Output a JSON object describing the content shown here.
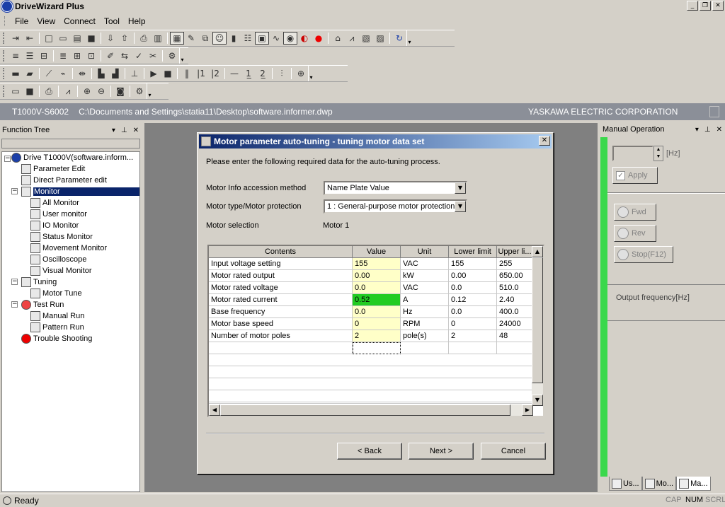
{
  "app": {
    "title": "DriveWizard Plus"
  },
  "window_controls": {
    "minimize": "_",
    "restore": "❐",
    "close": "✕"
  },
  "menu": [
    "File",
    "View",
    "Connect",
    "Tool",
    "Help"
  ],
  "pathbar": {
    "model": "T1000V-S6002",
    "path": "C:\\Documents and Settings\\statia11\\Desktop\\software.informer.dwp",
    "corp": "YASKAWA ELECTRIC CORPORATION"
  },
  "function_tree": {
    "title": "Function Tree",
    "nodes": [
      {
        "label": "Drive T1000V(software.inform...",
        "icon": "drive-icon"
      },
      {
        "label": "Parameter Edit",
        "icon": "parameter-edit-icon"
      },
      {
        "label": "Direct Parameter edit",
        "icon": "direct-parameter-icon"
      },
      {
        "label": "Monitor",
        "icon": "monitor-icon"
      },
      {
        "label": "All Monitor",
        "icon": "all-monitor-icon"
      },
      {
        "label": "User monitor",
        "icon": "user-monitor-icon"
      },
      {
        "label": "IO Monitor",
        "icon": "io-monitor-icon"
      },
      {
        "label": "Status Monitor",
        "icon": "status-monitor-icon"
      },
      {
        "label": "Movement Monitor",
        "icon": "movement-monitor-icon"
      },
      {
        "label": "Oscilloscope",
        "icon": "oscilloscope-icon"
      },
      {
        "label": "Visual Monitor",
        "icon": "visual-monitor-icon"
      },
      {
        "label": "Tuning",
        "icon": "tuning-icon"
      },
      {
        "label": "Motor Tune",
        "icon": "motor-tune-icon"
      },
      {
        "label": "Test Run",
        "icon": "test-run-icon"
      },
      {
        "label": "Manual Run",
        "icon": "manual-run-icon"
      },
      {
        "label": "Pattern Run",
        "icon": "pattern-run-icon"
      },
      {
        "label": "Trouble Shooting",
        "icon": "trouble-shooting-icon"
      }
    ]
  },
  "dialog": {
    "title": "Motor parameter auto-tuning - tuning motor data set",
    "instruction": "Please enter the following required data for the auto-tuning process.",
    "info_method_label": "Motor Info accession method",
    "info_method_value": "Name Plate Value",
    "motor_type_label": "Motor type/Motor protection",
    "motor_type_value": "1 : General-purpose motor protection",
    "motor_selection_label": "Motor selection",
    "motor_selection_value": "Motor 1",
    "table": {
      "headers": [
        "Contents",
        "Value",
        "Unit",
        "Lower limit",
        "Upper li..."
      ],
      "rows": [
        [
          "Input voltage setting",
          "155",
          "VAC",
          "155",
          "255"
        ],
        [
          "Motor rated output",
          "0.00",
          "kW",
          "0.00",
          "650.00"
        ],
        [
          "Motor rated voltage",
          "0.0",
          "VAC",
          "0.0",
          "510.0"
        ],
        [
          "Motor rated current",
          "0.52",
          "A",
          "0.12",
          "2.40"
        ],
        [
          "Base frequency",
          "0.0",
          "Hz",
          "0.0",
          "400.0"
        ],
        [
          "Motor base speed",
          "0",
          "RPM",
          "0",
          "24000"
        ],
        [
          "Number of motor poles",
          "2",
          "pole(s)",
          "2",
          "48"
        ]
      ]
    },
    "buttons": {
      "back": "< Back",
      "next": "Next >",
      "cancel": "Cancel"
    }
  },
  "manual_operation": {
    "title": "Manual Operation",
    "freq_unit": "[Hz]",
    "apply": "Apply",
    "fwd": "Fwd",
    "rev": "Rev",
    "stop": "Stop(F12)",
    "output_freq": "Output frequency[Hz]"
  },
  "bottom_tabs": [
    "Us...",
    "Mo...",
    "Ma..."
  ],
  "status": {
    "text": "Ready",
    "cap": "CAP",
    "num": "NUM",
    "scrl": "SCRL"
  },
  "colors": {
    "title_gradient_start": "#0a246a",
    "selected": "#0a246a",
    "value_cell": "#ffffc8",
    "highlight_cell": "#22cc22",
    "green_bar": "#3ad84c"
  }
}
